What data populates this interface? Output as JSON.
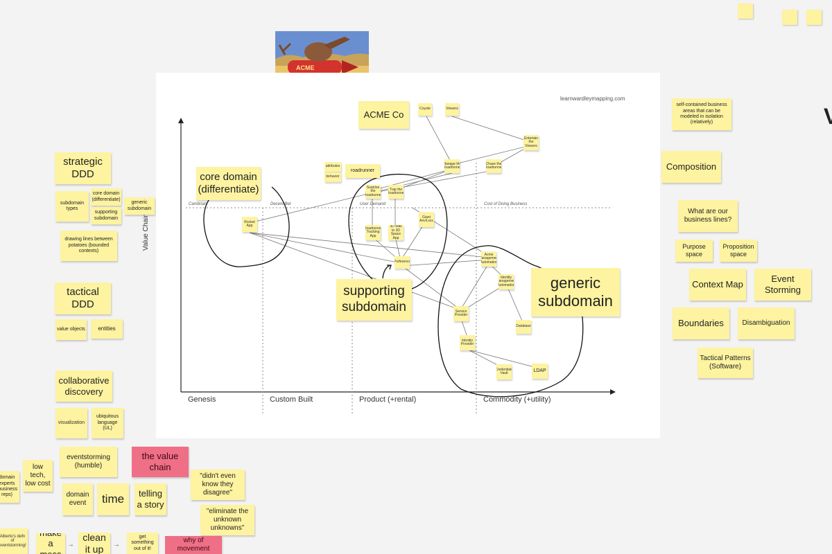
{
  "map": {
    "source_label": "learnwardleymapping.com",
    "y_axis_label": "Value Chain",
    "x_axis": [
      "Genesis",
      "Custom Built",
      "Product (+rental)",
      "Commodity (+utility)"
    ],
    "stages": [
      "Cambrian",
      "Decent Bet",
      "User Demand",
      "Cost of Doing Business"
    ],
    "title_note": "ACME Co",
    "components": {
      "coyote": "Coyote",
      "viewers": "Viewers",
      "entertain": "Entertain the Viewers",
      "attributes": "attributes",
      "behavior": "behavior",
      "roadrunner": "roadrunner",
      "manage": "Manage the Roadrunner",
      "chase": "Chase the Roadrunner",
      "surprise": "Surprise the Roadrunner",
      "trap": "Trap the Roadrunner",
      "rocket": "Rocket App",
      "roadrunner_tracking": "Roadrunner Tracking App",
      "3d_wall": "3D Wall to 3D Space App",
      "giant_anvil": "Giant Anvil.xxx",
      "preference": "Preference",
      "acme_mgmt": "Acme Management Automation",
      "identity_automation": "Identity Management Automation",
      "service_provider": "Service Provider",
      "identity_provider": "Identity Provider",
      "database": "Database",
      "credentials": "Credentials Vault",
      "ldap": "LDAP"
    },
    "callouts": {
      "core": "core domain (differentiate)",
      "supporting": "supporting subdomain",
      "generic": "generic subdomain"
    }
  },
  "left_notes": {
    "strategic": "strategic DDD",
    "subdomain_types": "subdomain types",
    "core_domain": "core domain (differentiate)",
    "supporting": "supporting subdomain",
    "generic": "generic subdomain",
    "drawing_lines": "drawing lines between potatoes (bounded contexts)",
    "tactical": "tactical DDD",
    "value_objects": "value objects",
    "entities": "entities",
    "collaborative": "collaborative discovery",
    "visualization": "visualization",
    "ubiquitous": "ubiquitous language (UL)",
    "eventstorming": "eventstorming (humble)",
    "value_chain": "the value chain",
    "low_tech": "low tech, low cost",
    "domain_experts": "domain experts (business reps)",
    "domain_event": "domain event",
    "time": "time",
    "telling_story": "telling a story",
    "didnt_know": "\"didn't even know they disagree\"",
    "eliminate": "\"eliminate the unknown unknowns\"",
    "albertos": "Alberto's defn of eventstorming!",
    "make_mess": "make a mess",
    "clean_it_up": "clean it up",
    "get_something": "get something out of it!",
    "why_movement": "why of movement"
  },
  "right_notes": {
    "self_contained": "self-contained business areas that can be modeled in isolation (relatively)",
    "composition": "Composition",
    "business_lines": "What are our business lines?",
    "purpose_space": "Purpose space",
    "proposition_space": "Proposition space",
    "context_map": "Context Map",
    "event_storming": "Event Storming",
    "boundaries": "Boundaries",
    "disambiguation": "Disambiguation",
    "tactical_patterns": "Tactical Patterns (Software)",
    "edge_letter": "V"
  },
  "colors": {
    "sticky": "#fdf3a0",
    "pink": "#ef6f86",
    "board": "#f3f3f3"
  }
}
